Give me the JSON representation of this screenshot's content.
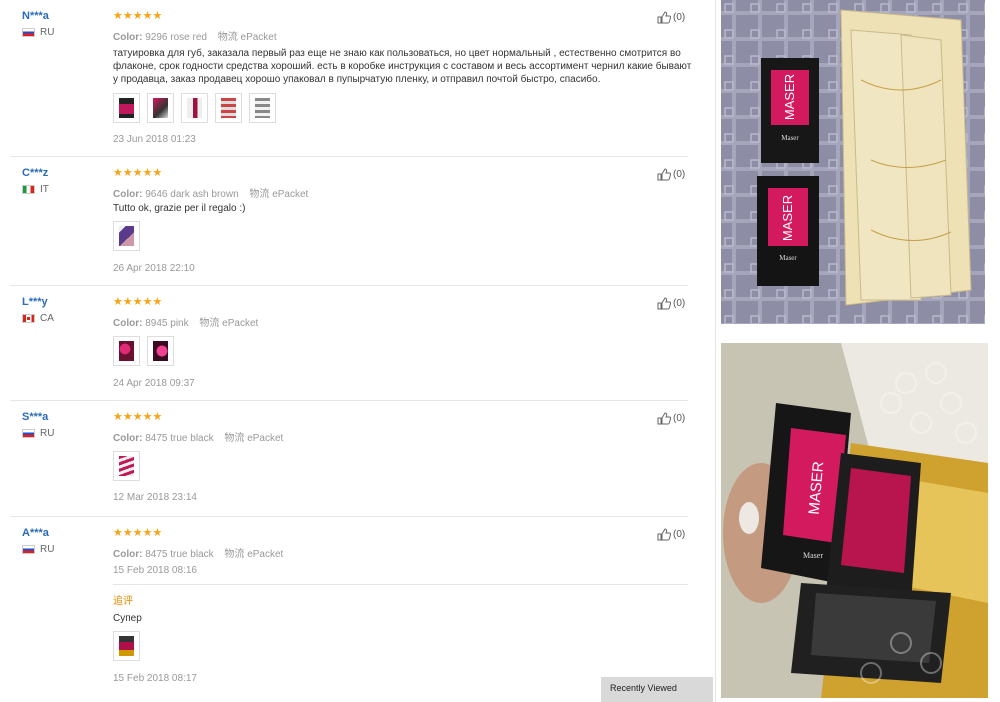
{
  "labels": {
    "color_prefix": "Color:",
    "shipping_prefix": "物流",
    "shipping": "ePacket",
    "stars": "★★★★★"
  },
  "reviews": [
    {
      "user": "N***a",
      "country": "RU",
      "flag": "ru",
      "color": "9296 rose red",
      "helpful": "(0)",
      "text": "татуировка для губ, заказала первый раз еще не знаю как пользоваться, но цвет нормальный , естественно смотрится во флаконе, срок годности средства хороший. есть в коробке инструкция с составом и весь ассортимент чернил какие бывают у продавца, заказ продавец хорошо упаковал в пупырчатую пленку, и отправил почтой быстро, спасибо.",
      "date": "23 Jun 2018 01:23",
      "photo_count": 5
    },
    {
      "user": "C***z",
      "country": "IT",
      "flag": "it",
      "color": "9646 dark ash brown",
      "helpful": "(0)",
      "text": "Tutto ok, grazie per il regalo :)",
      "date": "26 Apr 2018 22:10",
      "photo_count": 1
    },
    {
      "user": "L***y",
      "country": "CA",
      "flag": "ca",
      "color": "8945 pink",
      "helpful": "(0)",
      "text": "",
      "date": "24 Apr 2018 09:37",
      "photo_count": 2
    },
    {
      "user": "S***a",
      "country": "RU",
      "flag": "ru",
      "color": "8475 true black",
      "helpful": "(0)",
      "text": "",
      "date": "12 Mar 2018 23:14",
      "photo_count": 1
    },
    {
      "user": "A***a",
      "country": "RU",
      "flag": "ru",
      "color": "8475 true black",
      "helpful": "(0)",
      "text": "",
      "date": "15 Feb 2018 08:16",
      "photo_count": 0,
      "followup": {
        "label": "追评",
        "text": "Супер",
        "date": "15 Feb 2018 08:17",
        "photo_count": 1
      }
    }
  ],
  "recently_viewed": "Recently Viewed",
  "side_photos": [
    {
      "brand": "MASER",
      "sub": "Maser"
    },
    {
      "brand": "MASER",
      "sub": "Maser"
    }
  ],
  "colors": {
    "star": "#f7a416",
    "user": "#2a6bb8",
    "followup": "#e78a00",
    "brand_pink": "#d41a5f"
  }
}
